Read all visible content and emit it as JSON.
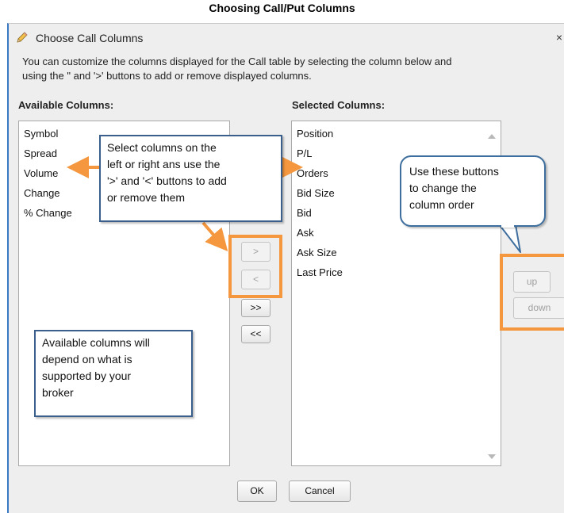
{
  "page_title": "Choosing Call/Put Columns",
  "dialog": {
    "title": "Choose Call Columns",
    "close_label": "×",
    "description_line1": "You can customize the columns displayed for the Call table by selecting the column below and",
    "description_line2": "using the \" and '>' buttons to add or remove displayed columns.",
    "available_heading": "Available Columns:",
    "selected_heading": "Selected Columns:",
    "available_columns": [
      "Symbol",
      "Spread",
      "Volume",
      "Change",
      "% Change"
    ],
    "selected_columns": [
      "Position",
      "P/L",
      "Orders",
      "Bid Size",
      "Bid",
      "Ask",
      "Ask Size",
      "Last Price"
    ],
    "buttons": {
      "add": ">",
      "remove": "<",
      "add_all": ">>",
      "remove_all": "<<",
      "up": "up",
      "down": "down",
      "ok": "OK",
      "cancel": "Cancel"
    }
  },
  "callouts": {
    "select": [
      "Select columns on the",
      "left or right ans use the",
      "'>' and '<' buttons to add",
      "or remove them"
    ],
    "available": [
      "Available columns will",
      "depend on what is",
      "supported by your",
      "broker"
    ],
    "order": [
      "Use these buttons",
      "to change the",
      "column order"
    ]
  },
  "colors": {
    "highlight": "#f4973e",
    "callout_border": "#3a5f8c",
    "dialog_border": "#3a78c3"
  }
}
